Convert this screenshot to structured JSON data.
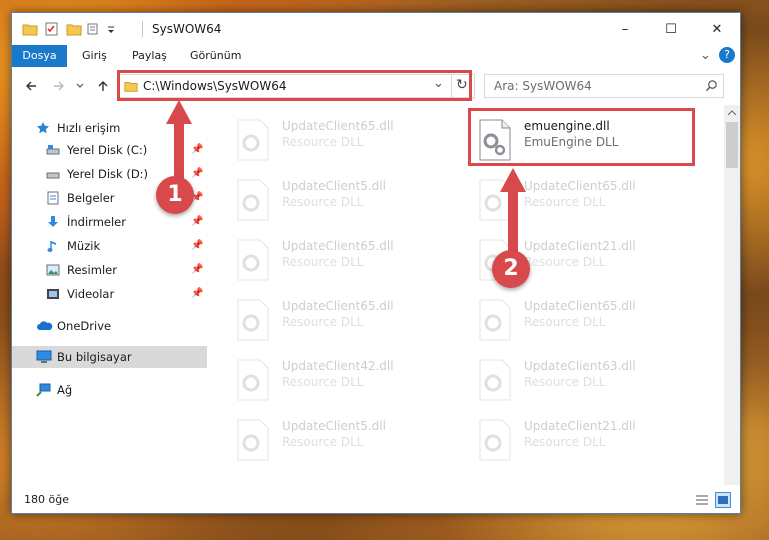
{
  "window": {
    "title": "SysWOW64",
    "controls": {
      "minimize": "–",
      "maximize": "☐",
      "close": "✕"
    }
  },
  "ribbon": {
    "tabs": [
      {
        "label": "Dosya"
      },
      {
        "label": "Giriş"
      },
      {
        "label": "Paylaş"
      },
      {
        "label": "Görünüm"
      }
    ],
    "collapse_glyph": "⌄",
    "help_glyph": "?"
  },
  "address_bar": {
    "path": "C:\\Windows\\SysWOW64",
    "dropdown_glyph": "⌄",
    "refresh_glyph": "↻"
  },
  "search": {
    "placeholder": "Ara: SysWOW64",
    "icon": "search-icon"
  },
  "nav": {
    "items": [
      {
        "label": "Hızlı erişim",
        "icon": "star-icon",
        "pinned": false
      },
      {
        "label": "Yerel Disk (C:)",
        "icon": "drive-icon",
        "pinned": true
      },
      {
        "label": "Yerel Disk (D:)",
        "icon": "drive-icon",
        "pinned": true
      },
      {
        "label": "Belgeler",
        "icon": "documents-icon",
        "pinned": true
      },
      {
        "label": "İndirmeler",
        "icon": "download-icon",
        "pinned": true
      },
      {
        "label": "Müzik",
        "icon": "music-icon",
        "pinned": true
      },
      {
        "label": "Resimler",
        "icon": "pictures-icon",
        "pinned": true
      },
      {
        "label": "Videolar",
        "icon": "video-icon",
        "pinned": true
      },
      {
        "label": "OneDrive",
        "icon": "cloud-icon",
        "pinned": false
      },
      {
        "label": "Bu bilgisayar",
        "icon": "computer-icon",
        "pinned": false,
        "selected": true
      },
      {
        "label": "Ağ",
        "icon": "network-icon",
        "pinned": false
      }
    ]
  },
  "files": {
    "left": [
      {
        "name": "UpdateClient65.dll",
        "desc": "Resource DLL"
      },
      {
        "name": "UpdateClient5.dll",
        "desc": "Resource DLL"
      },
      {
        "name": "UpdateClient65.dll",
        "desc": "Resource DLL"
      },
      {
        "name": "UpdateClient65.dll",
        "desc": "Resource DLL"
      },
      {
        "name": "UpdateClient42.dll",
        "desc": "Resource DLL"
      },
      {
        "name": "UpdateClient5.dll",
        "desc": "Resource DLL"
      }
    ],
    "right": [
      {
        "name": "emuengine.dll",
        "desc": "EmuEngine DLL",
        "highlighted": true
      },
      {
        "name": "UpdateClient65.dll",
        "desc": "Resource DLL"
      },
      {
        "name": "UpdateClient21.dll",
        "desc": "Resource DLL"
      },
      {
        "name": "UpdateClient65.dll",
        "desc": "Resource DLL"
      },
      {
        "name": "UpdateClient63.dll",
        "desc": "Resource DLL"
      },
      {
        "name": "UpdateClient21.dll",
        "desc": "Resource DLL"
      }
    ]
  },
  "status": {
    "count": "180 öğe"
  },
  "annotations": [
    {
      "number": "1",
      "color": "#d8494c"
    },
    {
      "number": "2",
      "color": "#d8494c"
    }
  ]
}
